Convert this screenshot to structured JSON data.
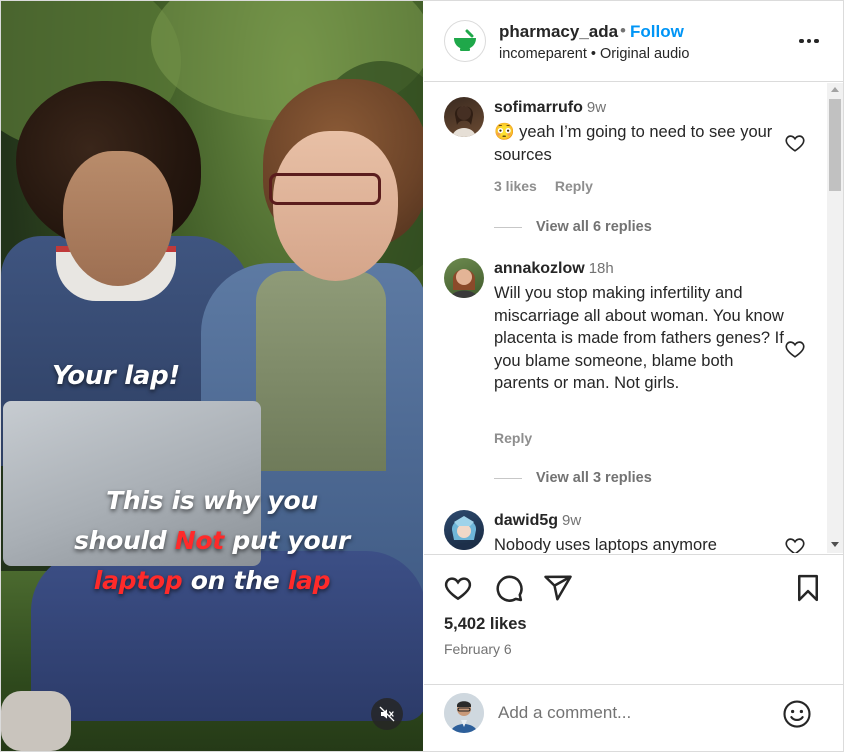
{
  "post": {
    "username": "pharmacy_ada",
    "separator": "•",
    "follow_label": "Follow",
    "subtitle": "incomeparent • Original audio",
    "likes": "5,402 likes",
    "date": "February 6"
  },
  "video": {
    "caption_top": "Your lap!",
    "caption_line1": "This is why you",
    "caption_line2_a": "should ",
    "caption_line2_red": "Not",
    "caption_line2_b": " put your",
    "caption_line3_red1": "laptop",
    "caption_line3_mid": " on the ",
    "caption_line3_red2": "lap"
  },
  "comments": [
    {
      "username": "sofimarrufo",
      "time": "9w",
      "emoji": "😳",
      "text": " yeah I’m going to need to see your sources",
      "likes": "3 likes",
      "reply_label": "Reply",
      "view_replies": "View all 6 replies"
    },
    {
      "username": "annakozlow",
      "time": "18h",
      "text": "Will you stop making infertility and miscarriage all about woman. You know placenta is made from fathers genes? If you blame someone, blame both parents or man. Not girls.",
      "reply_label": "Reply",
      "view_replies": "View all 3 replies"
    },
    {
      "username": "dawid5g",
      "time": "9w",
      "text": "Nobody uses laptops anymore"
    }
  ],
  "composer": {
    "placeholder": "Add a comment..."
  },
  "icons": {
    "brand_logo": "mortar-pestle-icon",
    "like": "heart-icon",
    "comment": "comment-bubble-icon",
    "share": "paper-plane-icon",
    "save": "bookmark-icon",
    "emoji": "smiley-icon",
    "mute": "speaker-muted-icon",
    "more": "more-options-icon"
  },
  "colors": {
    "follow": "#0095f6",
    "brand_green": "#1fa84a",
    "caption_red": "#ff2a2a"
  }
}
